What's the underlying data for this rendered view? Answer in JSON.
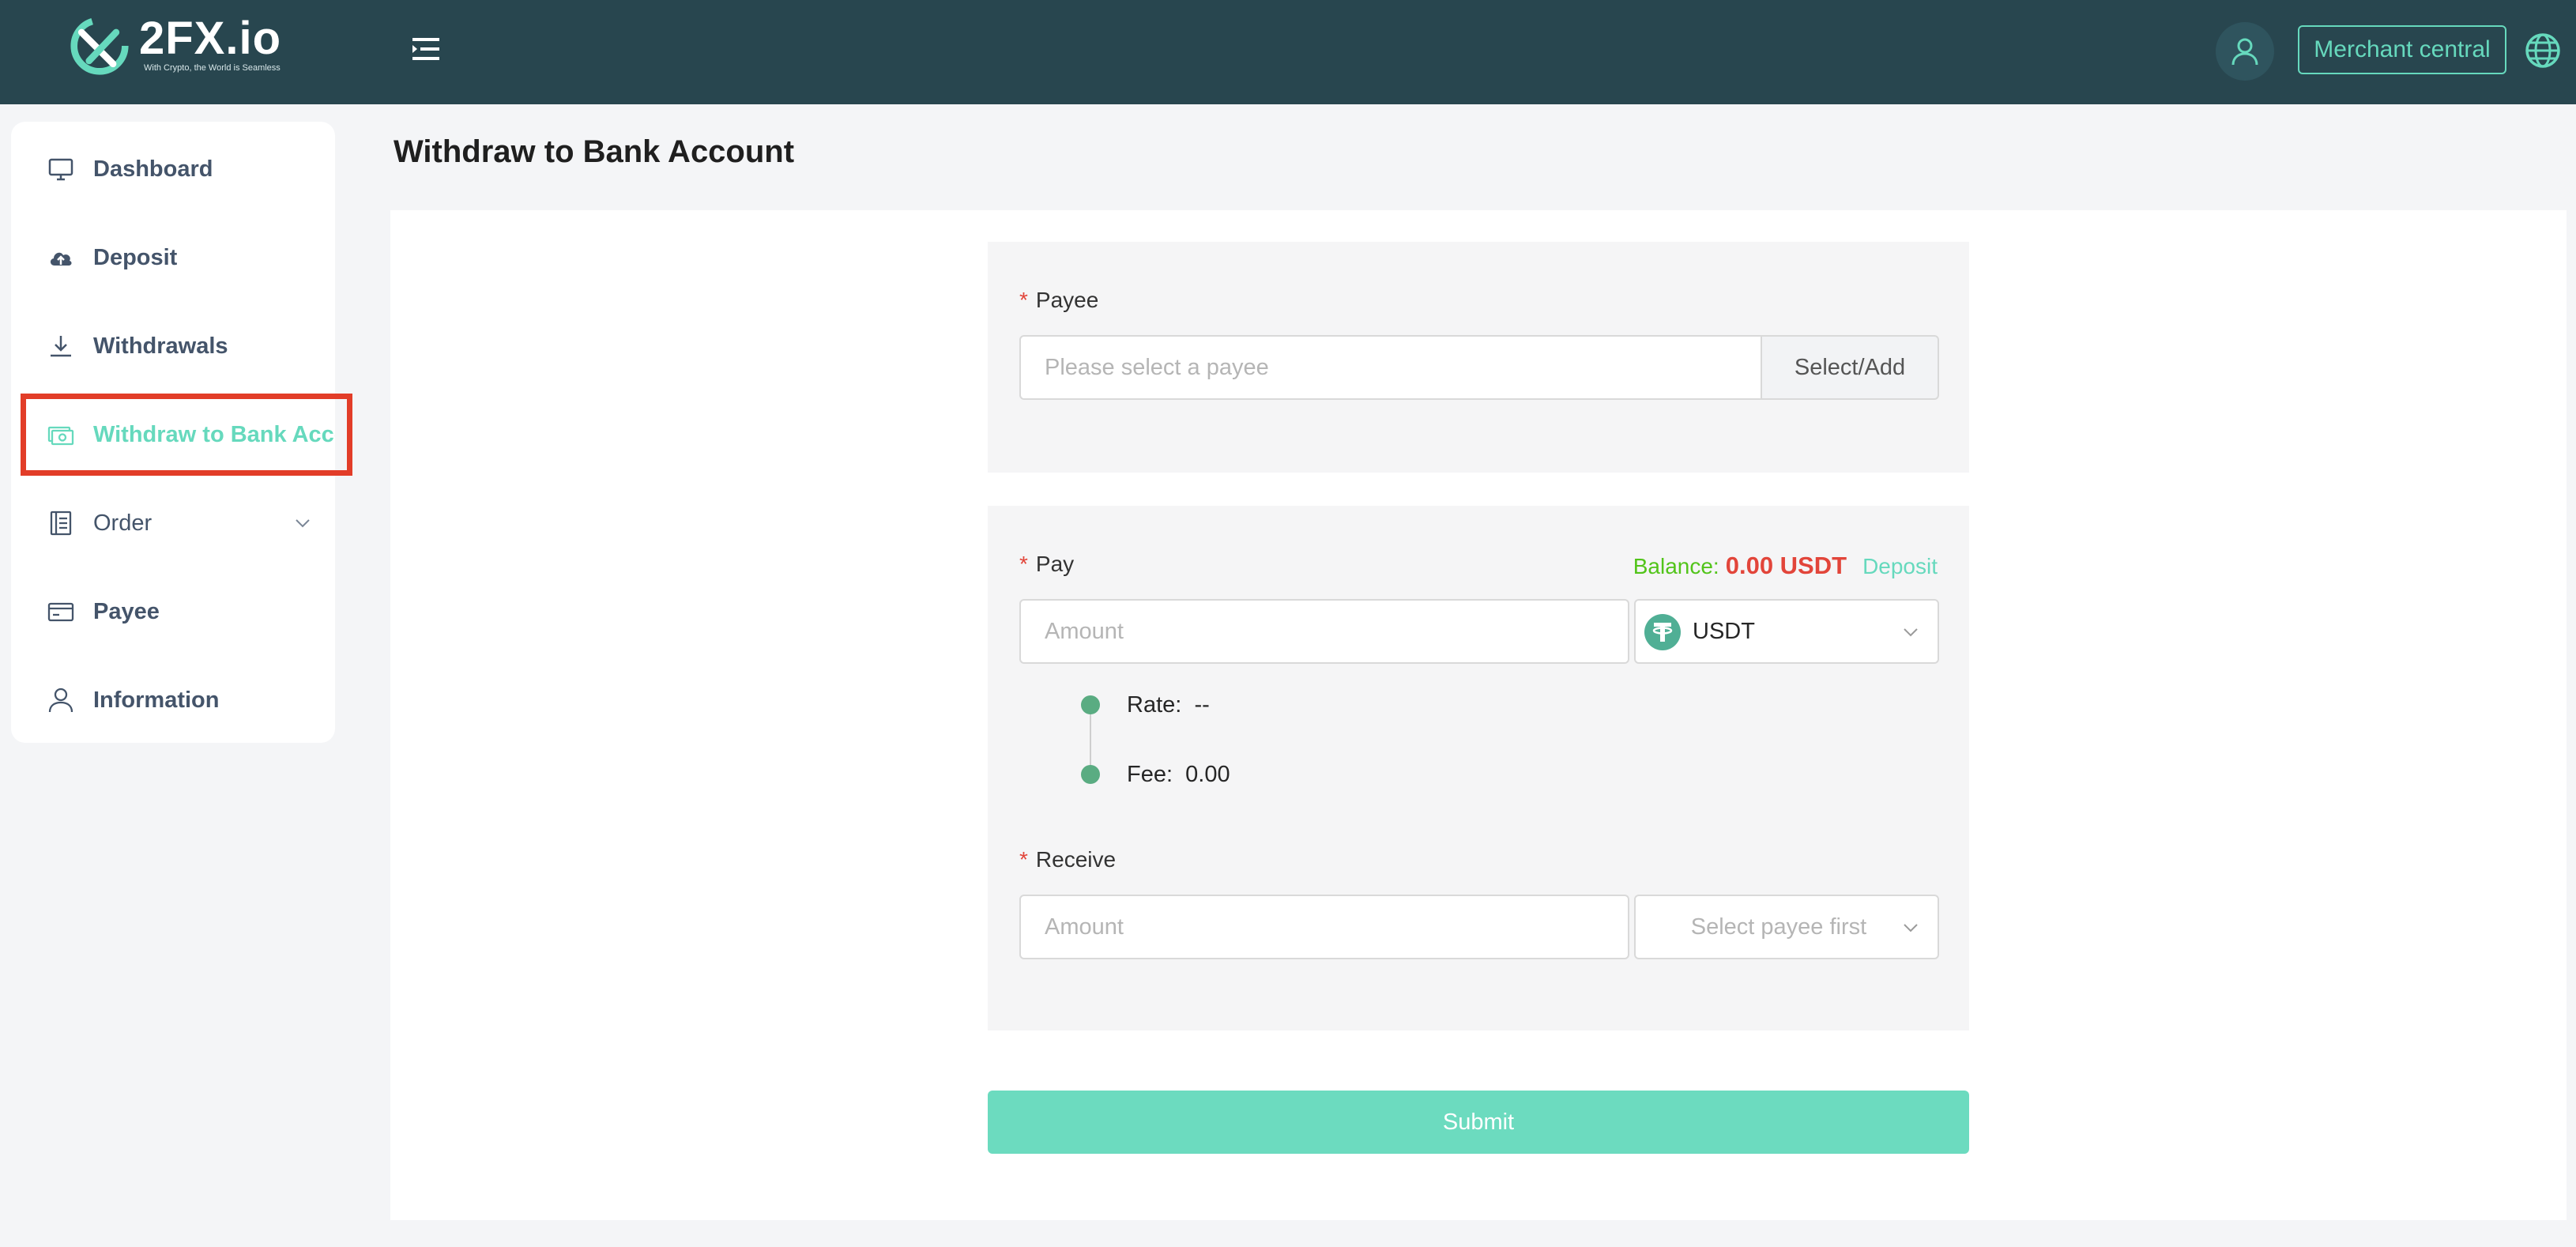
{
  "brand": {
    "name": "2FX.io",
    "tagline": "With Crypto, the World is Seamless"
  },
  "header": {
    "merchant_label": "Merchant central",
    "icons": {
      "menu": "menu-fold-icon",
      "user": "user-icon",
      "language": "globe-icon"
    },
    "accent_color": "#66d9bd",
    "bar_color": "#28464f"
  },
  "sidebar": {
    "items": [
      {
        "label": "Dashboard",
        "icon": "monitor-icon"
      },
      {
        "label": "Deposit",
        "icon": "cloud-upload-icon"
      },
      {
        "label": "Withdrawals",
        "icon": "download-icon"
      },
      {
        "label": "Withdraw to Bank Account",
        "icon": "cash-icon",
        "active": true
      },
      {
        "label": "Order",
        "icon": "receipt-icon",
        "has_submenu": true
      },
      {
        "label": "Payee",
        "icon": "credit-card-icon"
      },
      {
        "label": "Information",
        "icon": "user-icon"
      }
    ],
    "highlight_color": "#e23d28"
  },
  "page": {
    "title": "Withdraw to Bank Account"
  },
  "form": {
    "payee": {
      "label": "Payee",
      "placeholder": "Please select a payee",
      "button": "Select/Add"
    },
    "pay": {
      "label": "Pay",
      "placeholder": "Amount",
      "currency": "USDT",
      "currency_icon": "tether-icon",
      "balance_label": "Balance:",
      "balance_value": "0.00 USDT",
      "deposit_link": "Deposit"
    },
    "rate": {
      "label": "Rate:",
      "value": "--"
    },
    "fee": {
      "label": "Fee:",
      "value": "0.00"
    },
    "receive": {
      "label": "Receive",
      "placeholder": "Amount",
      "currency_placeholder": "Select payee first"
    },
    "required_marker": "*",
    "submit_label": "Submit"
  }
}
